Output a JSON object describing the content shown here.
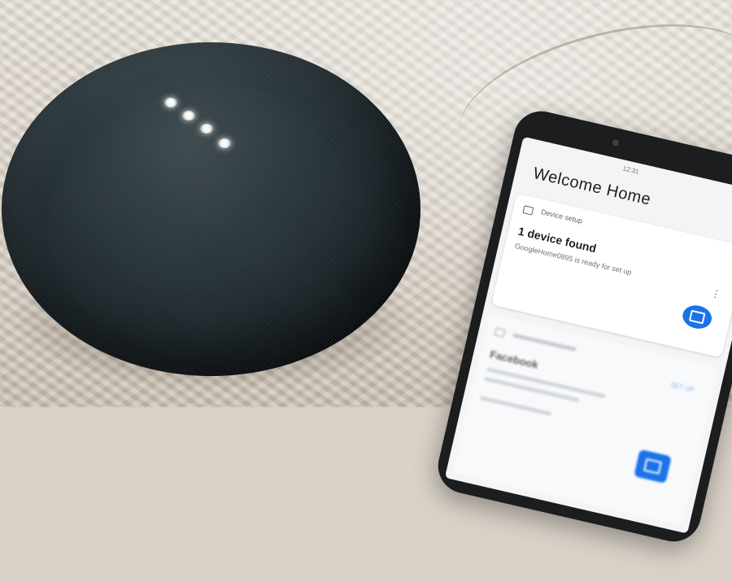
{
  "screen": {
    "status_time": "12:31",
    "title": "Welcome Home",
    "setup_card": {
      "label": "Device setup",
      "heading": "1 device found",
      "description": "GoogleHome0895 is ready for set up",
      "more_icon": "more-vert-icon",
      "device_icon": "cast-device-icon",
      "accent": "#1a73e8"
    },
    "second_card": {
      "heading": "Facebook",
      "link_label": "SET UP"
    }
  },
  "speaker": {
    "led_count": 4,
    "color": "#1f2a2f"
  }
}
